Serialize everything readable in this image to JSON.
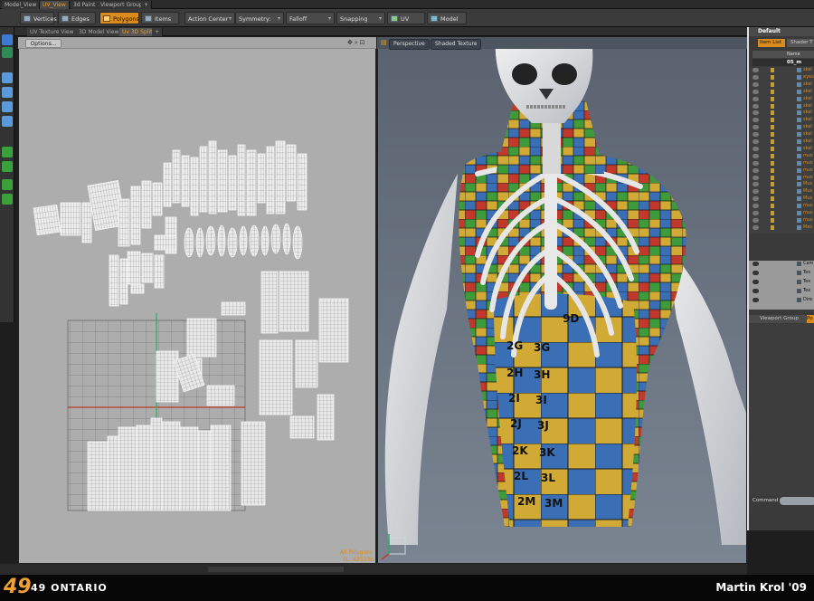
{
  "top_tabs": [
    "Model_View",
    "UV_View",
    "3d Paint",
    "Viewport Group",
    "+"
  ],
  "toolbar": {
    "vertices": "Vertices",
    "edges": "Edges",
    "polygons": "Polygons",
    "items": "Items",
    "action_center": "Action Center",
    "symmetry": "Symmetry: Off",
    "falloff": "Falloff",
    "snapping": "Snapping",
    "uv_edit": "UV Edit",
    "model": "Model"
  },
  "sub_tabs": [
    "UV Texture View",
    "3D Model View",
    "Uv 3D Split",
    "+"
  ],
  "uv_view": {
    "options_label": "Options...",
    "status_label": "All Polygons",
    "status_count": "SL: 825336"
  },
  "viewport": {
    "perspective_label": "Perspective",
    "shading_label": "Shaded Texture"
  },
  "uv_checker_labels": [
    "2G",
    "3G",
    "2H",
    "3H",
    "2I",
    "3I",
    "2J",
    "3J",
    "2K",
    "3K",
    "2L",
    "3L",
    "2M",
    "3M",
    "9D"
  ],
  "right_panel": {
    "title": "Default",
    "tab_item_list": "Item List",
    "tab_shader": "Shader T",
    "column_name": "Name",
    "group_name": "05_m",
    "items": [
      "skel",
      "eyes",
      "skel",
      "skel",
      "skel",
      "skel",
      "skel",
      "skel",
      "skel",
      "skel",
      "skel",
      "skel",
      "mus",
      "mus",
      "mus",
      "mus",
      "Mus",
      "Mus",
      "Mus",
      "mus",
      "mus",
      "mus",
      "Mes"
    ],
    "scene_items": [
      "Cam",
      "Tex",
      "Tex",
      "Tex",
      "Dire"
    ],
    "tab_viewport_group": "Viewport Group",
    "tab_po": "Po",
    "command_label": "Command"
  },
  "branding": {
    "logo": "49",
    "company": "49 ONTARIO",
    "credit": "Martin Krol '09"
  },
  "colors": {
    "accent": "#d98b1c",
    "brand_orange": "#f0a030",
    "uv_background": "#adadad",
    "viewport_background": "#5c6675",
    "checker_green": "#3f9a3a",
    "checker_yellow": "#d0aa35",
    "checker_blue": "#3a6fb5",
    "checker_red": "#c0392b"
  }
}
